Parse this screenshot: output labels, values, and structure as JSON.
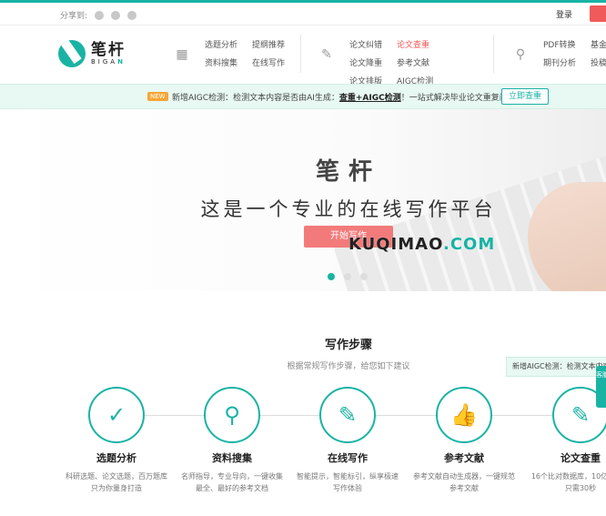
{
  "topbar": {
    "share_label": "分享到:",
    "login": "登录"
  },
  "logo": {
    "cn": "笔杆",
    "en_a": "BIGA",
    "en_b": "N"
  },
  "nav": {
    "group1": [
      "选题分析",
      "提纲推荐",
      "资料搜集",
      "在线写作"
    ],
    "group2": [
      "论文纠错",
      "论文查重",
      "论文降重",
      "参考文献",
      "论文排版",
      "AIGC检测"
    ],
    "group3": [
      "PDF转换",
      "基金",
      "期刊分析",
      "投稿"
    ]
  },
  "notice": {
    "badge": "NEW",
    "text_a": "新增AIGC检测：检测文本内容是否由AI生成：",
    "text_link": "查重+AIGC检测",
    "text_b": "！一站式解决毕业论文重复问题！",
    "button": "立即查重"
  },
  "banner": {
    "title": "笔杆",
    "subtitle": "这是一个专业的在线写作平台",
    "button": "开始写作",
    "watermark_a": "KUQIMAO",
    "watermark_b": ".COM"
  },
  "steps": {
    "title": "写作步骤",
    "subtitle": "根据常规写作步骤，给您如下建议",
    "items": [
      {
        "name": "选题分析",
        "desc": "科研选题、论文选题，百万题库只为你量身打造"
      },
      {
        "name": "资料搜集",
        "desc": "名师指导，专业导向，一键收集最全、最好的参考文档"
      },
      {
        "name": "在线写作",
        "desc": "智能提示，智能标引，纵享极速写作体验"
      },
      {
        "name": "参考文献",
        "desc": "参考文献自动生成器，一键规范参考文献"
      },
      {
        "name": "论文查重",
        "desc": "16个比对数据库，10亿文献，只需30秒"
      }
    ]
  },
  "float": {
    "tip": "新增AIGC检测：检测文本内容",
    "side": "客服"
  }
}
